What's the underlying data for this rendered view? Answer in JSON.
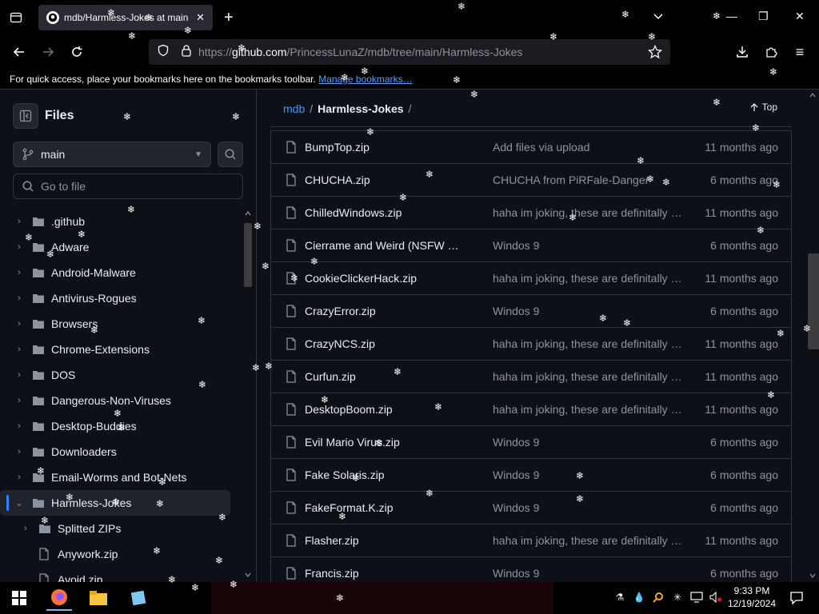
{
  "browser": {
    "tab_title": "mdb/Harmless-Jokes at main ·",
    "url_prefix": "https://",
    "url_host": "github.com",
    "url_path": "/PrincessLunaZ/mdb/tree/main/Harmless-Jokes",
    "bookmarks_text": "For quick access, place your bookmarks here on the bookmarks toolbar.",
    "bookmarks_link": "Manage bookmarks…"
  },
  "sidebar": {
    "title": "Files",
    "branch": "main",
    "goto_placeholder": "Go to file",
    "items": [
      {
        "label": ".github",
        "type": "folder",
        "expanded": false,
        "depth": 0
      },
      {
        "label": "Adware",
        "type": "folder",
        "expanded": false,
        "depth": 0
      },
      {
        "label": "Android-Malware",
        "type": "folder",
        "expanded": false,
        "depth": 0
      },
      {
        "label": "Antivirus-Rogues",
        "type": "folder",
        "expanded": false,
        "depth": 0
      },
      {
        "label": "Browsers",
        "type": "folder",
        "expanded": false,
        "depth": 0
      },
      {
        "label": "Chrome-Extensions",
        "type": "folder",
        "expanded": false,
        "depth": 0
      },
      {
        "label": "DOS",
        "type": "folder",
        "expanded": false,
        "depth": 0
      },
      {
        "label": "Dangerous-Non-Viruses",
        "type": "folder",
        "expanded": false,
        "depth": 0
      },
      {
        "label": "Desktop-Buddies",
        "type": "folder",
        "expanded": false,
        "depth": 0
      },
      {
        "label": "Downloaders",
        "type": "folder",
        "expanded": false,
        "depth": 0
      },
      {
        "label": "Email-Worms and Bot-Nets",
        "type": "folder",
        "expanded": false,
        "depth": 0
      },
      {
        "label": "Harmless-Jokes",
        "type": "folder",
        "expanded": true,
        "depth": 0,
        "selected": true
      },
      {
        "label": "Splitted ZIPs",
        "type": "folder",
        "expanded": false,
        "depth": 1
      },
      {
        "label": "Anywork.zip",
        "type": "file",
        "depth": 1
      },
      {
        "label": "Avoid.zip",
        "type": "file",
        "depth": 1
      }
    ]
  },
  "main": {
    "breadcrumb_repo": "mdb",
    "breadcrumb_sep": "/",
    "breadcrumb_current": "Harmless-Jokes",
    "top_label": "Top",
    "files": [
      {
        "name": "BumpTop.zip",
        "message": "Add files via upload",
        "age": "11 months ago"
      },
      {
        "name": "CHUCHA.zip",
        "message": "CHUCHA from PiRFale-Danger",
        "age": "6 months ago"
      },
      {
        "name": "ChilledWindows.zip",
        "message": "haha im joking, these are definitally r...",
        "age": "11 months ago"
      },
      {
        "name": "Cierrame and Weird (NSFW 18...",
        "message": "Windos 9",
        "age": "6 months ago"
      },
      {
        "name": "CookieClickerHack.zip",
        "message": "haha im joking, these are definitally r...",
        "age": "11 months ago"
      },
      {
        "name": "CrazyError.zip",
        "message": "Windos 9",
        "age": "6 months ago"
      },
      {
        "name": "CrazyNCS.zip",
        "message": "haha im joking, these are definitally r...",
        "age": "11 months ago"
      },
      {
        "name": "Curfun.zip",
        "message": "haha im joking, these are definitally r...",
        "age": "11 months ago"
      },
      {
        "name": "DesktopBoom.zip",
        "message": "haha im joking, these are definitally r...",
        "age": "11 months ago"
      },
      {
        "name": "Evil Mario Virus.zip",
        "message": "Windos 9",
        "age": "6 months ago"
      },
      {
        "name": "Fake Solaris.zip",
        "message": "Windos 9",
        "age": "6 months ago"
      },
      {
        "name": "FakeFormat.K.zip",
        "message": "Windos 9",
        "age": "6 months ago"
      },
      {
        "name": "Flasher.zip",
        "message": "haha im joking, these are definitally r...",
        "age": "11 months ago"
      },
      {
        "name": "Francis.zip",
        "message": "Windos 9",
        "age": "6 months ago"
      }
    ]
  },
  "taskbar": {
    "time": "9:33 PM",
    "date": "12/19/2024"
  },
  "colors": {
    "accent_link": "#4493f8",
    "selected_bar": "#2f81f7",
    "background": "#0d1117",
    "border": "#30363d"
  }
}
